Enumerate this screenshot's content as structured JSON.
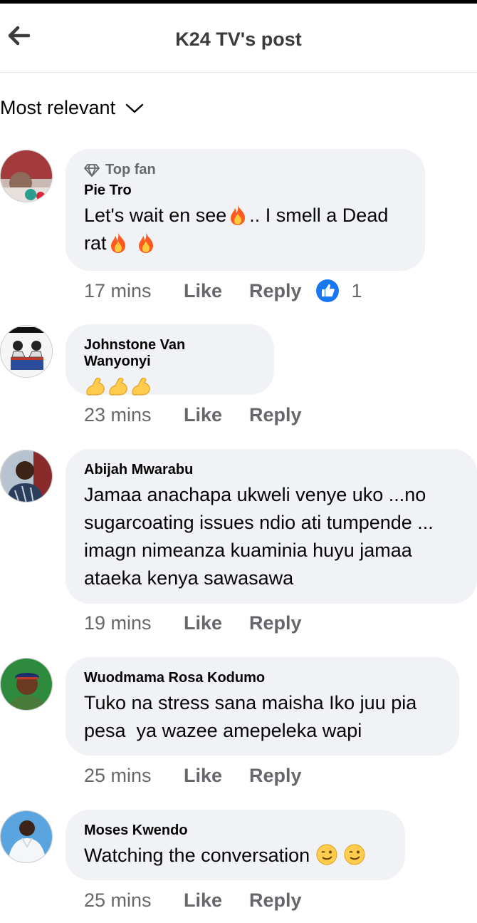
{
  "header": {
    "title": "K24 TV's post"
  },
  "sort": {
    "label": "Most relevant"
  },
  "comments": [
    {
      "badge": "Top fan",
      "name": "Pie Tro",
      "text_a": "Let's wait en see",
      "text_b": ".. I smell a Dead",
      "text_c": "rat",
      "time": "17 mins",
      "like": "Like",
      "reply": "Reply",
      "reaction_count": "1"
    },
    {
      "name": "Johnstone Van Wanyonyi",
      "time": "23 mins",
      "like": "Like",
      "reply": "Reply"
    },
    {
      "name": "Abijah Mwarabu",
      "text": "Jamaa anachapa ukweli venye uko ...no sugarcoating issues ndio ati tumpende ... imagn nimeanza kuaminia huyu jamaa ataeka kenya sawasawa",
      "time": "19 mins",
      "like": "Like",
      "reply": "Reply"
    },
    {
      "name": "Wuodmama Rosa Kodumo",
      "text": "Tuko na stress sana maisha Iko juu pia pesa  ya wazee amepeleka wapi",
      "time": "25 mins",
      "like": "Like",
      "reply": "Reply"
    },
    {
      "name": "Moses Kwendo",
      "text": "Watching the conversation ",
      "time": "25 mins",
      "like": "Like",
      "reply": "Reply"
    }
  ],
  "icons": {
    "back": "arrow-left-icon",
    "sort": "chevron-down-icon",
    "badge": "diamond-icon",
    "reaction": "thumbs-up-icon"
  },
  "colors": {
    "accent": "#1877f2",
    "bubble": "#f0f2f5",
    "secondary_text": "#65676b"
  }
}
